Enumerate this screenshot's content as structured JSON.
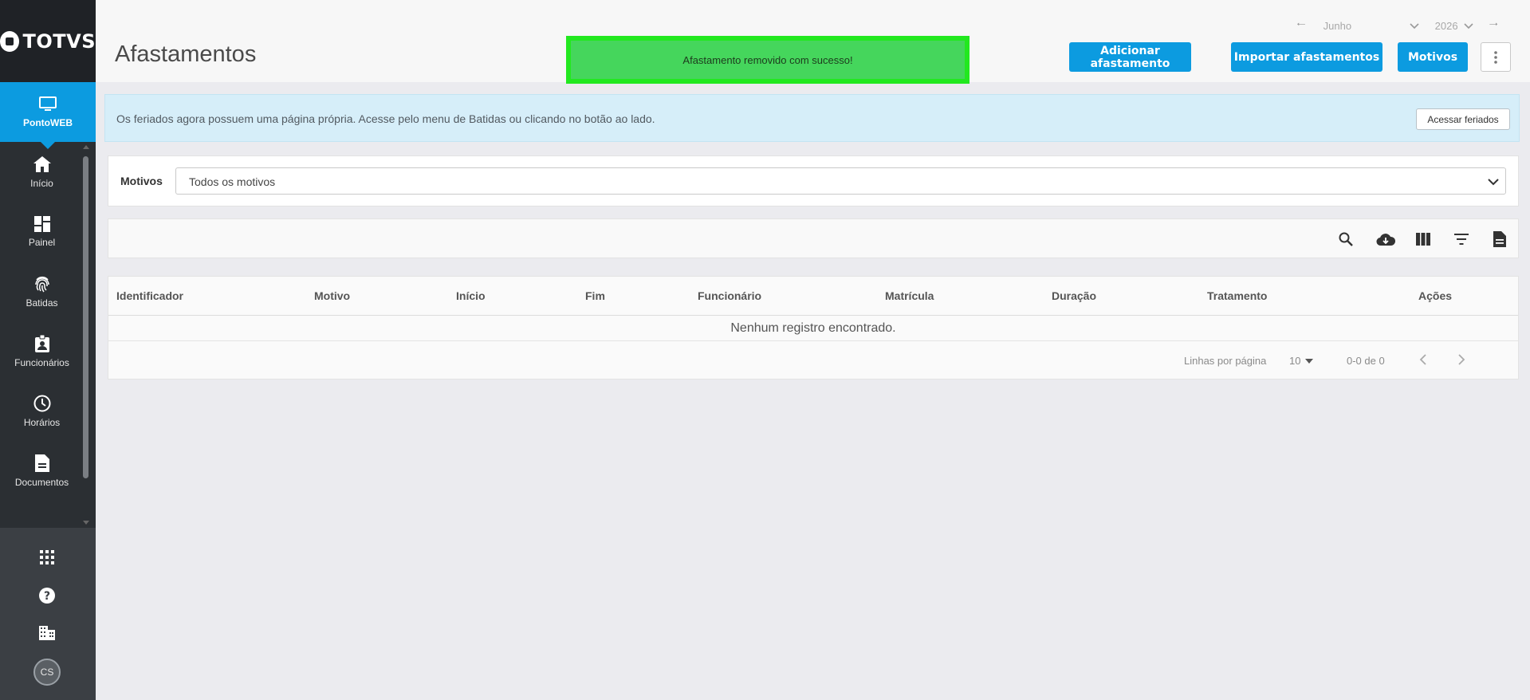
{
  "brand": {
    "name": "TOTVS",
    "product": "PontoWEB"
  },
  "sidebar": {
    "items": [
      {
        "label": "Início",
        "icon": "home-icon"
      },
      {
        "label": "Painel",
        "icon": "dashboard-icon"
      },
      {
        "label": "Batidas",
        "icon": "fingerprint-icon"
      },
      {
        "label": "Funcionários",
        "icon": "badge-icon"
      },
      {
        "label": "Horários",
        "icon": "clock-icon"
      },
      {
        "label": "Documentos",
        "icon": "document-icon"
      }
    ],
    "bottom_icons": [
      "apps-grid-icon",
      "help-icon",
      "building-icon"
    ],
    "avatar": "CS"
  },
  "header": {
    "title": "Afastamentos",
    "period": {
      "month": "Junho",
      "year": "2026"
    },
    "toast": "Afastamento removido com sucesso!",
    "buttons": {
      "add": "Adicionar afastamento",
      "import": "Importar afastamentos",
      "reasons": "Motivos"
    }
  },
  "banner": {
    "text": "Os feriados agora possuem uma página própria. Acesse pelo menu de Batidas ou clicando no botão ao lado.",
    "button": "Acessar feriados"
  },
  "filter": {
    "label": "Motivos",
    "value": "Todos os motivos"
  },
  "toolbar": {
    "icons": [
      "search-icon",
      "cloud-download-icon",
      "columns-icon",
      "filter-icon",
      "document-icon"
    ]
  },
  "table": {
    "columns": [
      "Identificador",
      "Motivo",
      "Início",
      "Fim",
      "Funcionário",
      "Matrícula",
      "Duração",
      "Tratamento",
      "Ações"
    ],
    "empty_message": "Nenhum registro encontrado.",
    "footer": {
      "rows_label": "Linhas por página",
      "rows_value": "10",
      "range": "0-0 de 0"
    }
  },
  "colors": {
    "primary": "#0c9be0",
    "sidebar": "#2b2f33",
    "toast": "#45d65c",
    "banner": "#d6eef9"
  }
}
